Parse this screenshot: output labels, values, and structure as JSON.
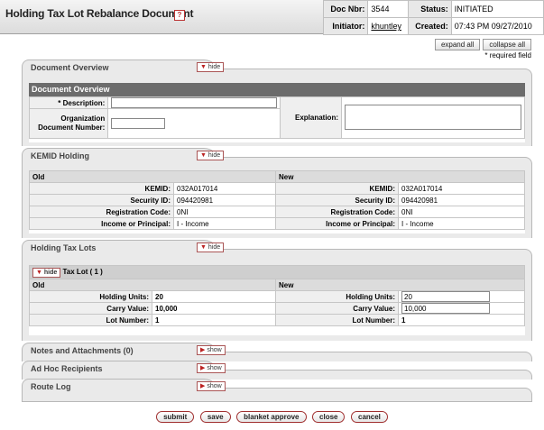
{
  "header": {
    "title": "Holding Tax Lot Rebalance Document",
    "help": "?",
    "doc_nbr_label": "Doc Nbr:",
    "doc_nbr": "3544",
    "status_label": "Status:",
    "status": "INITIATED",
    "initiator_label": "Initiator:",
    "initiator": "khuntley",
    "created_label": "Created:",
    "created": "07:43 PM 09/27/2010"
  },
  "top_buttons": {
    "expand": "expand all",
    "collapse": "collapse all"
  },
  "required_note": "* required field",
  "doc_overview": {
    "tab": "Document Overview",
    "toggle": "hide",
    "bar": "Document Overview",
    "description_label": "* Description:",
    "description_value": "",
    "org_doc_label": "Organization Document Number:",
    "org_doc_value": "",
    "explanation_label": "Explanation:",
    "explanation_value": ""
  },
  "kemid_holding": {
    "tab": "KEMID Holding",
    "toggle": "hide",
    "old_header": "Old",
    "new_header": "New",
    "rows": [
      {
        "label": "KEMID:",
        "old": "032A017014",
        "new": "032A017014"
      },
      {
        "label": "Security ID:",
        "old": "094420981",
        "new": "094420981"
      },
      {
        "label": "Registration Code:",
        "old": "0NI",
        "new": "0NI"
      },
      {
        "label": "Income or Principal:",
        "old": "I - Income",
        "new": "I - Income"
      }
    ]
  },
  "holding_tax_lots": {
    "tab": "Holding Tax Lots",
    "toggle": "hide",
    "sub_toggle": "hide",
    "sub_title": "Tax Lot ( 1 )",
    "old_header": "Old",
    "new_header": "New",
    "rows": [
      {
        "label": "Holding Units:",
        "old": "20",
        "new": "20",
        "editable": true
      },
      {
        "label": "Carry Value:",
        "old": "10,000",
        "new": "10,000",
        "editable": true
      },
      {
        "label": "Lot Number:",
        "old": "1",
        "new": "1",
        "editable": false
      }
    ]
  },
  "notes": {
    "tab": "Notes and Attachments (0)",
    "toggle": "show"
  },
  "adhoc": {
    "tab": "Ad Hoc Recipients",
    "toggle": "show"
  },
  "route_log": {
    "tab": "Route Log",
    "toggle": "show"
  },
  "bottom_buttons": [
    "submit",
    "save",
    "blanket approve",
    "close",
    "cancel"
  ],
  "colors": {
    "accent": "#a03030",
    "tab_bg": "#eaeaea",
    "bar_bg": "#6c6c6c"
  }
}
